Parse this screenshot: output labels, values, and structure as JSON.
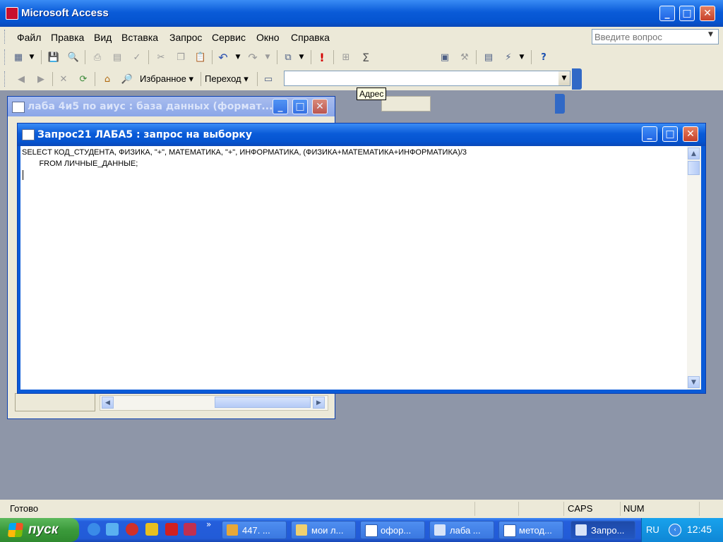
{
  "app": {
    "title": "Microsoft Access"
  },
  "menu": {
    "items": [
      "Файл",
      "Правка",
      "Вид",
      "Вставка",
      "Запрос",
      "Сервис",
      "Окно",
      "Справка"
    ],
    "help_placeholder": "Введите вопрос"
  },
  "web_toolbar": {
    "favorites": "Избранное",
    "goto": "Переход",
    "address_value": "",
    "address_tooltip": "Адрес"
  },
  "db_window": {
    "title": "лаба 4и5 по аиус : база данных (формат..."
  },
  "query_window": {
    "title": "Запрос21 ЛАБА5 : запрос на выборку",
    "sql_line1": "SELECT КОД_СТУДЕНТА, ФИЗИКА, \"+\", МАТЕМАТИКА, \"+\", ИНФОРМАТИКА, (ФИЗИКА+МАТЕМАТИКА+ИНФОРМАТИКА)/3",
    "sql_line2": "        FROM ЛИЧНЫЕ_ДАННЫЕ;"
  },
  "status": {
    "text": "Готово",
    "caps": "CAPS",
    "num": "NUM"
  },
  "taskbar": {
    "start": "пуск",
    "tasks": [
      "447. ...",
      "мои л...",
      "офор...",
      "лаба ...",
      "метод...",
      "Запро..."
    ],
    "lang": "RU",
    "clock": "12:45"
  },
  "colors": {
    "titlebar": "#0554d0",
    "chrome": "#ece9d8",
    "desktop": "#8e96a8",
    "start": "#3b9a3b"
  }
}
